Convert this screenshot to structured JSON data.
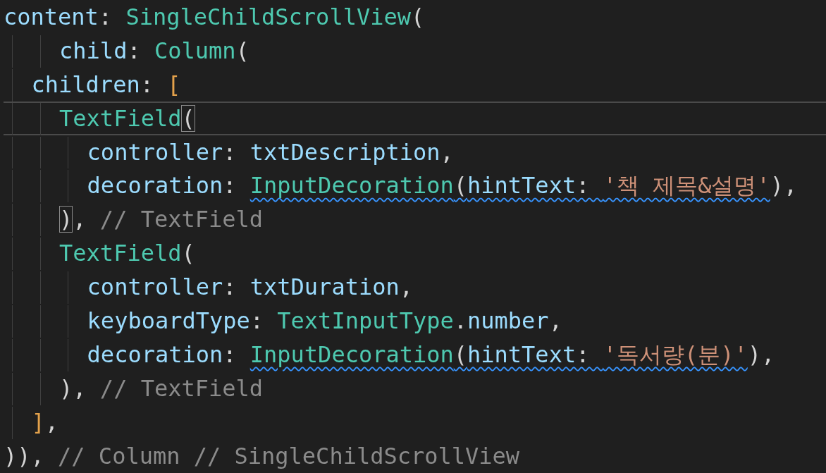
{
  "lines": [
    {
      "current": false,
      "tokens": [
        {
          "kind": "prop",
          "text": "content",
          "warning": false,
          "matched": false
        },
        {
          "kind": "punct",
          "text": ": ",
          "warning": false,
          "matched": false
        },
        {
          "kind": "type",
          "text": "SingleChildScrollView",
          "warning": false,
          "matched": false
        },
        {
          "kind": "punct",
          "text": "(",
          "warning": false,
          "matched": false
        }
      ]
    },
    {
      "current": false,
      "tokens": [
        {
          "kind": "prop",
          "text": "    child",
          "warning": false,
          "matched": false
        },
        {
          "kind": "punct",
          "text": ": ",
          "warning": false,
          "matched": false
        },
        {
          "kind": "type",
          "text": "Column",
          "warning": false,
          "matched": false
        },
        {
          "kind": "punct",
          "text": "(",
          "warning": false,
          "matched": false
        }
      ]
    },
    {
      "current": false,
      "tokens": [
        {
          "kind": "prop",
          "text": "  children",
          "warning": false,
          "matched": false
        },
        {
          "kind": "punct",
          "text": ": ",
          "warning": false,
          "matched": false
        },
        {
          "kind": "bracket",
          "text": "[",
          "warning": false,
          "matched": false
        }
      ]
    },
    {
      "current": true,
      "tokens": [
        {
          "kind": "type",
          "text": "    TextField",
          "warning": false,
          "matched": false
        },
        {
          "kind": "punct",
          "text": "(",
          "warning": false,
          "matched": true
        }
      ]
    },
    {
      "current": false,
      "tokens": [
        {
          "kind": "prop",
          "text": "      controller",
          "warning": false,
          "matched": false
        },
        {
          "kind": "punct",
          "text": ": ",
          "warning": false,
          "matched": false
        },
        {
          "kind": "prop",
          "text": "txtDescription",
          "warning": false,
          "matched": false
        },
        {
          "kind": "punct",
          "text": ",",
          "warning": false,
          "matched": false
        }
      ]
    },
    {
      "current": false,
      "tokens": [
        {
          "kind": "prop",
          "text": "      decoration",
          "warning": false,
          "matched": false
        },
        {
          "kind": "punct",
          "text": ": ",
          "warning": false,
          "matched": false
        },
        {
          "kind": "type",
          "text": "InputDecoration",
          "warning": true,
          "matched": false
        },
        {
          "kind": "punct",
          "text": "(",
          "warning": true,
          "matched": false
        },
        {
          "kind": "prop",
          "text": "hintText",
          "warning": true,
          "matched": false
        },
        {
          "kind": "punct",
          "text": ": ",
          "warning": true,
          "matched": false
        },
        {
          "kind": "string",
          "text": "'책 제목&설명'",
          "warning": true,
          "matched": false
        },
        {
          "kind": "punct",
          "text": "),",
          "warning": false,
          "matched": false
        }
      ]
    },
    {
      "current": false,
      "tokens": [
        {
          "kind": "punct",
          "text": "    )",
          "warning": false,
          "matched": true
        },
        {
          "kind": "punct",
          "text": ", ",
          "warning": false,
          "matched": false
        },
        {
          "kind": "comment",
          "text": "// TextField",
          "warning": false,
          "matched": false
        }
      ]
    },
    {
      "current": false,
      "tokens": [
        {
          "kind": "type",
          "text": "    TextField",
          "warning": false,
          "matched": false
        },
        {
          "kind": "punct",
          "text": "(",
          "warning": false,
          "matched": false
        }
      ]
    },
    {
      "current": false,
      "tokens": [
        {
          "kind": "prop",
          "text": "      controller",
          "warning": false,
          "matched": false
        },
        {
          "kind": "punct",
          "text": ": ",
          "warning": false,
          "matched": false
        },
        {
          "kind": "prop",
          "text": "txtDuration",
          "warning": false,
          "matched": false
        },
        {
          "kind": "punct",
          "text": ",",
          "warning": false,
          "matched": false
        }
      ]
    },
    {
      "current": false,
      "tokens": [
        {
          "kind": "prop",
          "text": "      keyboardType",
          "warning": false,
          "matched": false
        },
        {
          "kind": "punct",
          "text": ": ",
          "warning": false,
          "matched": false
        },
        {
          "kind": "type",
          "text": "TextInputType",
          "warning": false,
          "matched": false
        },
        {
          "kind": "punct",
          "text": ".",
          "warning": false,
          "matched": false
        },
        {
          "kind": "prop",
          "text": "number",
          "warning": false,
          "matched": false
        },
        {
          "kind": "punct",
          "text": ",",
          "warning": false,
          "matched": false
        }
      ]
    },
    {
      "current": false,
      "tokens": [
        {
          "kind": "prop",
          "text": "      decoration",
          "warning": false,
          "matched": false
        },
        {
          "kind": "punct",
          "text": ": ",
          "warning": false,
          "matched": false
        },
        {
          "kind": "type",
          "text": "InputDecoration",
          "warning": true,
          "matched": false
        },
        {
          "kind": "punct",
          "text": "(",
          "warning": true,
          "matched": false
        },
        {
          "kind": "prop",
          "text": "hintText",
          "warning": true,
          "matched": false
        },
        {
          "kind": "punct",
          "text": ": ",
          "warning": true,
          "matched": false
        },
        {
          "kind": "string",
          "text": "'독서량(분)'",
          "warning": true,
          "matched": false
        },
        {
          "kind": "punct",
          "text": "),",
          "warning": false,
          "matched": false
        }
      ]
    },
    {
      "current": false,
      "tokens": [
        {
          "kind": "punct",
          "text": "    ), ",
          "warning": false,
          "matched": false
        },
        {
          "kind": "comment",
          "text": "// TextField",
          "warning": false,
          "matched": false
        }
      ]
    },
    {
      "current": false,
      "tokens": [
        {
          "kind": "bracket",
          "text": "  ]",
          "warning": false,
          "matched": false
        },
        {
          "kind": "punct",
          "text": ",",
          "warning": false,
          "matched": false
        }
      ]
    },
    {
      "current": false,
      "tokens": [
        {
          "kind": "punct",
          "text": ")), ",
          "warning": false,
          "matched": false
        },
        {
          "kind": "comment",
          "text": "// Column // SingleChildScrollView",
          "warning": false,
          "matched": false
        }
      ]
    }
  ]
}
